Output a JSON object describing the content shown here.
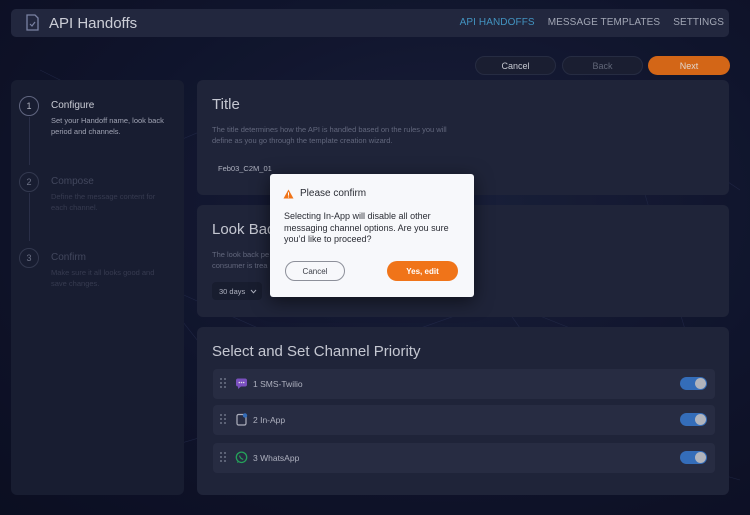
{
  "header": {
    "app_title": "API Handoffs",
    "app_icon": "handoff-doc-icon",
    "nav": [
      {
        "label": "API HANDOFFS",
        "active": true
      },
      {
        "label": "MESSAGE TEMPLATES",
        "active": false
      },
      {
        "label": "SETTINGS",
        "active": false
      }
    ]
  },
  "actions": {
    "cancel_label": "Cancel",
    "back_label": "Back",
    "next_label": "Next"
  },
  "steps": [
    {
      "number": "1",
      "title": "Configure",
      "desc": "Set your Handoff name, look back period and channels.",
      "active": true
    },
    {
      "number": "2",
      "title": "Compose",
      "desc": "Define the message content for each channel.",
      "active": false
    },
    {
      "number": "3",
      "title": "Confirm",
      "desc": "Make sure it all looks good and save changes.",
      "active": false
    }
  ],
  "title_card": {
    "heading": "Title",
    "desc": "The title determines how the API is handled based on the rules you will define as you go through the template creation wizard.",
    "value": "Feb03_C2M_01"
  },
  "lookback_card": {
    "heading": "Look Back",
    "desc": "The look back pe",
    "desc2": "consumer is trea",
    "selected": "30 days"
  },
  "channel_card": {
    "heading": "Select and Set Channel Priority",
    "channels": [
      {
        "label": "1 SMS-Twilio",
        "icon": "sms-chat-icon",
        "enabled": true
      },
      {
        "label": "2 In-App",
        "icon": "in-app-phone-icon",
        "enabled": true
      },
      {
        "label": "3 WhatsApp",
        "icon": "whatsapp-icon",
        "enabled": true
      }
    ]
  },
  "modal": {
    "title": "Please confirm",
    "message": "Selecting In-App will disable all other messaging channel options. Are you sure you’d like to proceed?",
    "cancel_label": "Cancel",
    "confirm_label": "Yes, edit"
  },
  "colors": {
    "accent": "#f07419",
    "nav_active": "#4aa6d8",
    "toggle_on": "#3b7bd1",
    "warning": "#f07419"
  }
}
